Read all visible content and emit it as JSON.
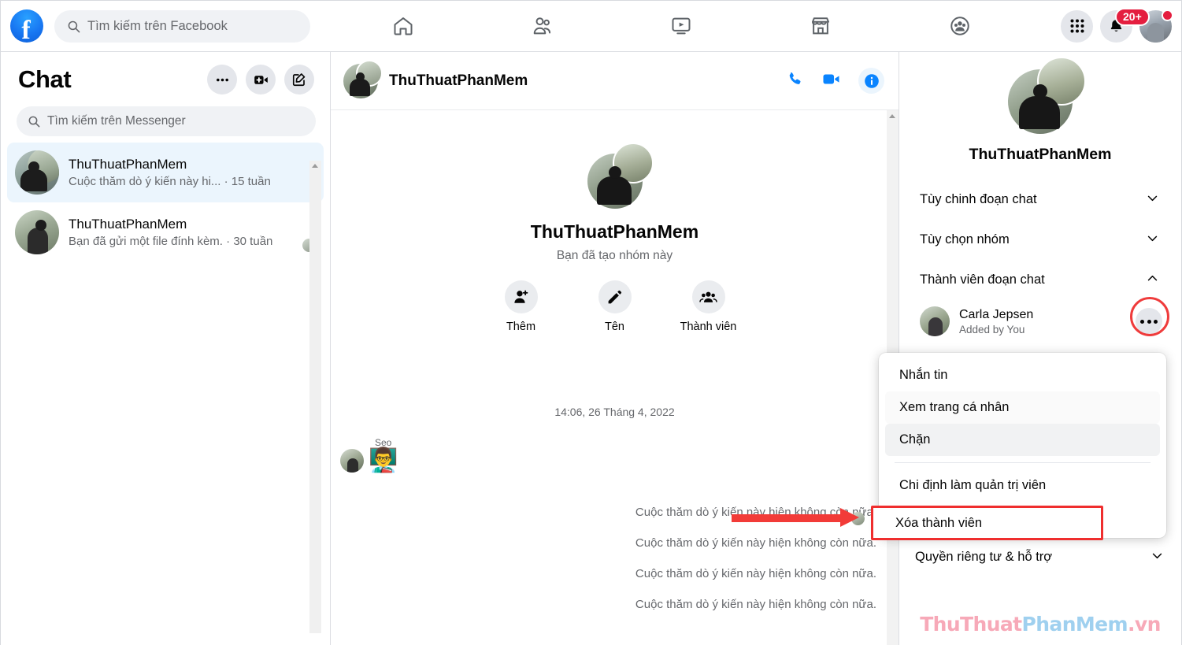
{
  "topbar": {
    "logo_icon": "facebook-logo",
    "search_placeholder": "Tìm kiếm trên Facebook",
    "search_icon": "search-icon",
    "nav": [
      {
        "name": "home",
        "icon": "home-icon"
      },
      {
        "name": "friends",
        "icon": "friends-icon"
      },
      {
        "name": "watch",
        "icon": "video-play-icon"
      },
      {
        "name": "marketplace",
        "icon": "storefront-icon"
      },
      {
        "name": "groups",
        "icon": "groups-icon"
      }
    ],
    "menu_icon": "grid-apps-icon",
    "notifications_icon": "bell-icon",
    "notifications_badge": "20+",
    "profile_icon": "user-avatar"
  },
  "left_panel": {
    "title": "Chat",
    "actions": [
      {
        "name": "more-options",
        "icon": "ellipsis-icon"
      },
      {
        "name": "new-video-room",
        "icon": "video-plus-icon"
      },
      {
        "name": "new-message",
        "icon": "compose-icon"
      }
    ],
    "search_placeholder": "Tìm kiếm trên Messenger",
    "search_icon": "search-icon",
    "conversations": [
      {
        "name": "ThuThuatPhanMem",
        "preview": "Cuộc thăm dò ý kiến này hi...",
        "time": "15 tuần",
        "separator": "·",
        "active": true
      },
      {
        "name": "ThuThuatPhanMem",
        "preview": "Bạn đã gửi một file đính kèm.",
        "time": "30 tuần",
        "separator": "·",
        "active": false
      }
    ]
  },
  "thread": {
    "title": "ThuThuatPhanMem",
    "header_actions": [
      {
        "name": "voice-call",
        "icon": "phone-icon"
      },
      {
        "name": "video-call",
        "icon": "video-camera-icon"
      },
      {
        "name": "conversation-info",
        "icon": "info-icon"
      }
    ],
    "intro": {
      "name": "ThuThuatPhanMem",
      "subtitle": "Bạn đã tạo nhóm này",
      "actions": [
        {
          "label": "Thêm",
          "icon": "add-person-icon"
        },
        {
          "label": "Tên",
          "icon": "pencil-icon"
        },
        {
          "label": "Thành viên",
          "icon": "members-icon"
        }
      ]
    },
    "timestamp": "14:06, 26 Tháng 4, 2022",
    "message": {
      "sender_label": "Seo",
      "emoji": "👨‍🏫"
    },
    "poll_messages": [
      "Cuộc thăm dò ý kiến này hiện không còn nữa.",
      "Cuộc thăm dò ý kiến này hiện không còn nữa.",
      "Cuộc thăm dò ý kiến này hiện không còn nữa.",
      "Cuộc thăm dò ý kiến này hiện không còn nữa."
    ]
  },
  "right_panel": {
    "name": "ThuThuatPhanMem",
    "sections": [
      {
        "label": "Tùy chinh đoạn chat",
        "chevron": "chevron-down-icon",
        "expanded": false
      },
      {
        "label": "Tùy chọn nhóm",
        "chevron": "chevron-down-icon",
        "expanded": false
      },
      {
        "label": "Thành viên đoạn chat",
        "chevron": "chevron-up-icon",
        "expanded": true
      }
    ],
    "member": {
      "name": "Carla Jepsen",
      "sub": "Added by You",
      "more_icon": "ellipsis-icon"
    },
    "privacy": {
      "label": "Quyền riêng tư & hỗ trợ",
      "chevron": "chevron-down-icon"
    },
    "watermark": {
      "part1": "ThuThuat",
      "part2": "PhanMem",
      "part3": ".vn"
    }
  },
  "context_menu": {
    "items": [
      {
        "label": "Nhắn tin",
        "highlight": "none"
      },
      {
        "label": "Xem trang cá nhân",
        "highlight": "light"
      },
      {
        "label": "Chặn",
        "highlight": "hover"
      },
      {
        "label": "Chi định làm quản trị viên",
        "highlight": "none"
      },
      {
        "label": "Xóa thành viên",
        "highlight": "boxed"
      }
    ]
  },
  "annotations": {
    "arrow_color": "#f23b38",
    "box_color": "#ef2e2e",
    "ring_color": "#ef3b3b"
  }
}
